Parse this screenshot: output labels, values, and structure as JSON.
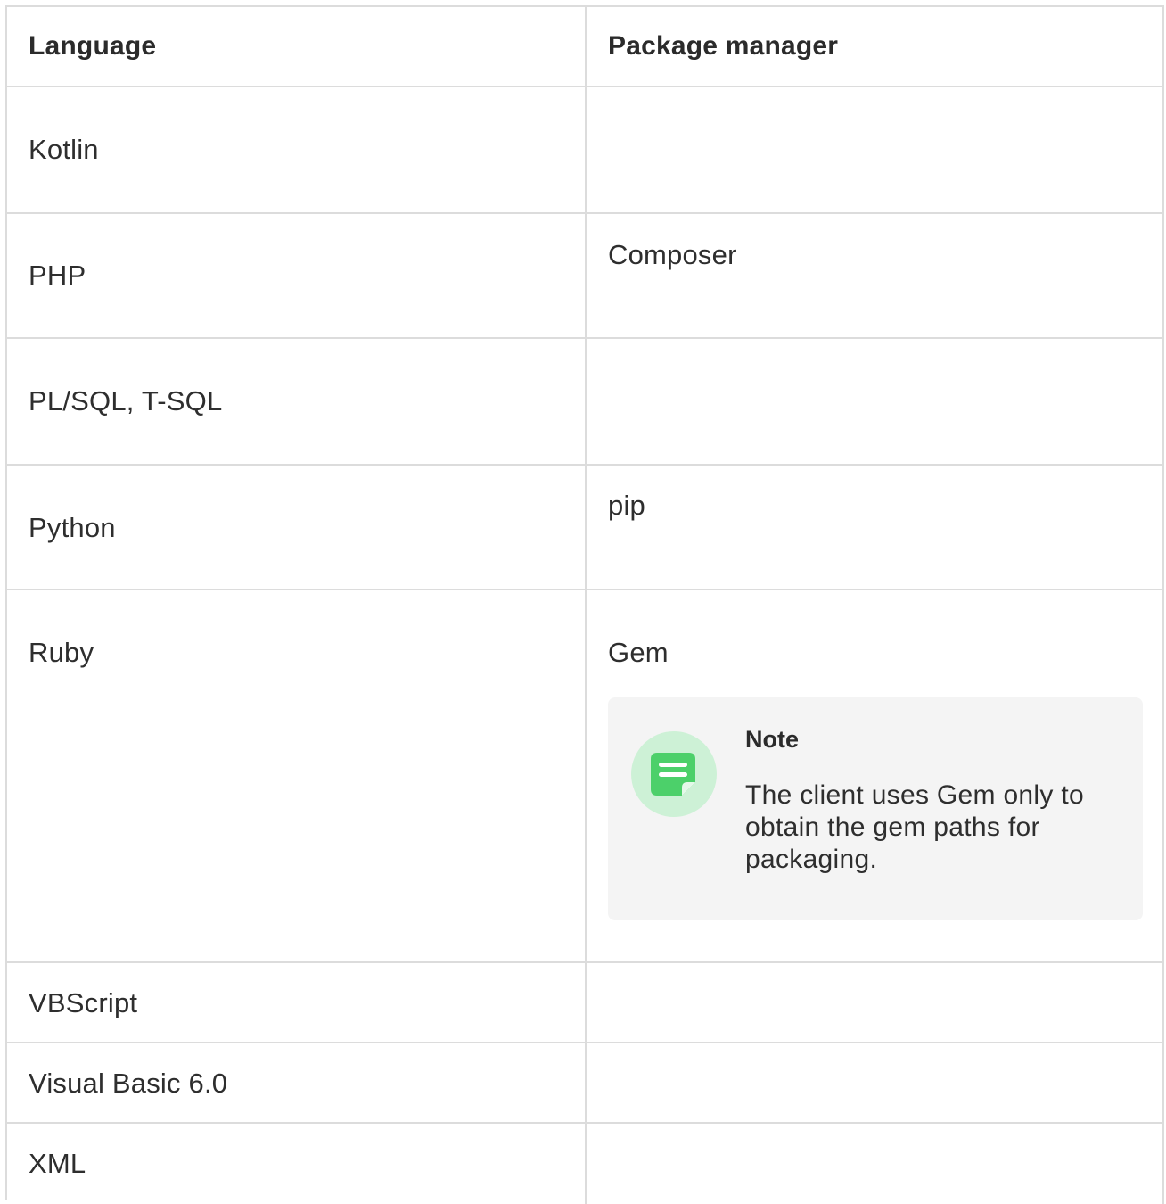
{
  "table": {
    "headers": {
      "language": "Language",
      "package_manager": "Package manager"
    },
    "rows": [
      {
        "language": "Kotlin",
        "package_manager": ""
      },
      {
        "language": "PHP",
        "package_manager": "Composer"
      },
      {
        "language": "PL/SQL, T-SQL",
        "package_manager": ""
      },
      {
        "language": "Python",
        "package_manager": "pip"
      },
      {
        "language": "Ruby",
        "package_manager": "Gem"
      },
      {
        "language": "VBScript",
        "package_manager": ""
      },
      {
        "language": "Visual Basic 6.0",
        "package_manager": ""
      },
      {
        "language": "XML",
        "package_manager": ""
      }
    ]
  },
  "note": {
    "title": "Note",
    "body": "The client uses Gem only to obtain the gem paths for packaging.",
    "icon": "note-icon",
    "accent_color": "#4cd06a",
    "icon_bg_color": "#cdf1d6"
  }
}
